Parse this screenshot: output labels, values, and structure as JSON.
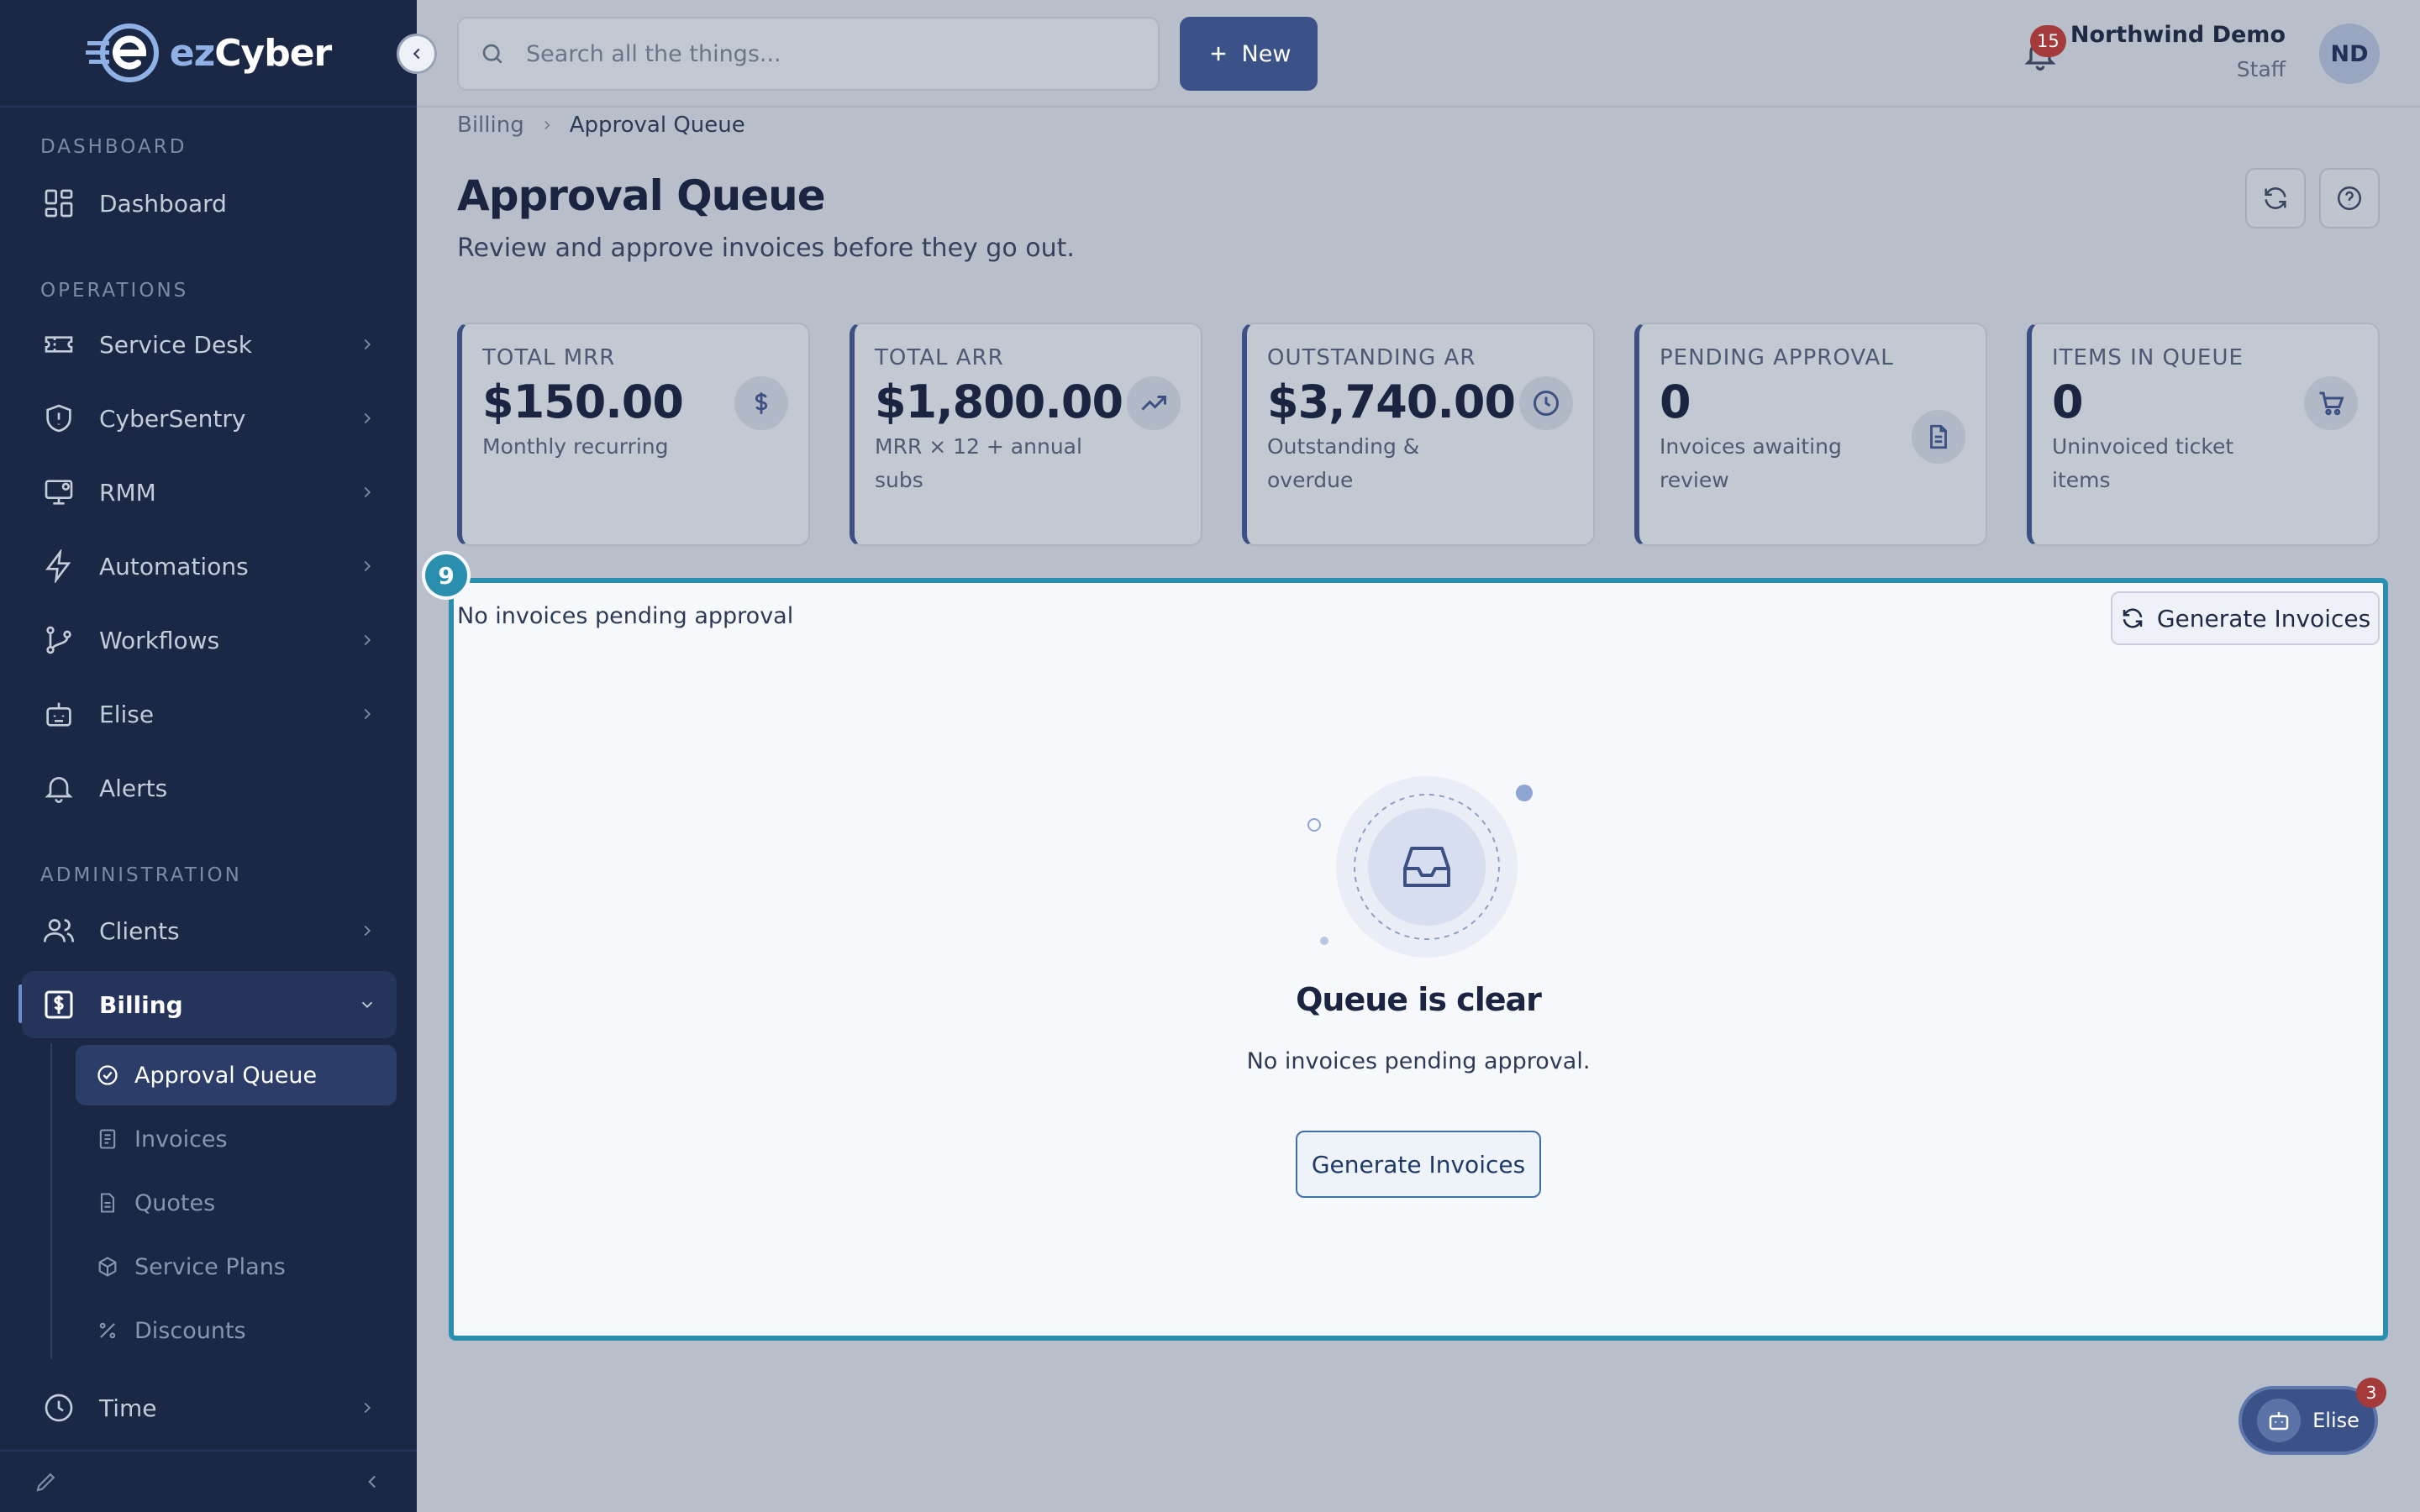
{
  "brand": {
    "name_prefix": "ez",
    "name_suffix": "Cyber"
  },
  "sidebar": {
    "sections": {
      "dashboard": "DASHBOARD",
      "operations": "OPERATIONS",
      "administration": "ADMINISTRATION"
    },
    "items": {
      "dashboard": "Dashboard",
      "service_desk": "Service Desk",
      "cybersentry": "CyberSentry",
      "rmm": "RMM",
      "automations": "Automations",
      "workflows": "Workflows",
      "elise": "Elise",
      "alerts": "Alerts",
      "clients": "Clients",
      "billing": "Billing",
      "time": "Time"
    },
    "billing_sub": {
      "approval_queue": "Approval Queue",
      "invoices": "Invoices",
      "quotes": "Quotes",
      "service_plans": "Service Plans",
      "discounts": "Discounts"
    }
  },
  "topbar": {
    "search_placeholder": "Search all the things...",
    "new_label": "New",
    "notifications_count": "15",
    "user_name": "Northwind Demo",
    "user_role": "Staff",
    "avatar_initials": "ND"
  },
  "breadcrumb": {
    "parent": "Billing",
    "current": "Approval Queue"
  },
  "page": {
    "title": "Approval Queue",
    "subtitle": "Review and approve invoices before they go out."
  },
  "stats": [
    {
      "label": "TOTAL MRR",
      "value": "$150.00",
      "desc": "Monthly recurring",
      "icon": "dollar-icon"
    },
    {
      "label": "TOTAL ARR",
      "value": "$1,800.00",
      "desc": "MRR × 12 + annual subs",
      "icon": "trending-up-icon"
    },
    {
      "label": "OUTSTANDING AR",
      "value": "$3,740.00",
      "desc": "Outstanding & overdue",
      "icon": "clock-icon"
    },
    {
      "label": "PENDING APPROVAL",
      "value": "0",
      "desc": "Invoices awaiting review",
      "icon": "document-icon"
    },
    {
      "label": "ITEMS IN QUEUE",
      "value": "0",
      "desc": "Uninvoiced ticket items",
      "icon": "cart-icon"
    }
  ],
  "queue": {
    "step_number": "9",
    "note": "No invoices pending approval",
    "generate_label": "Generate Invoices",
    "empty_title": "Queue is clear",
    "empty_text": "No invoices pending approval.",
    "empty_button": "Generate Invoices"
  },
  "assistant": {
    "label": "Elise",
    "badge": "3"
  },
  "colors": {
    "sidebar_bg": "#1b2845",
    "accent": "#3b5289",
    "highlight": "#2a8fae",
    "badge_red": "#a43a3a"
  }
}
